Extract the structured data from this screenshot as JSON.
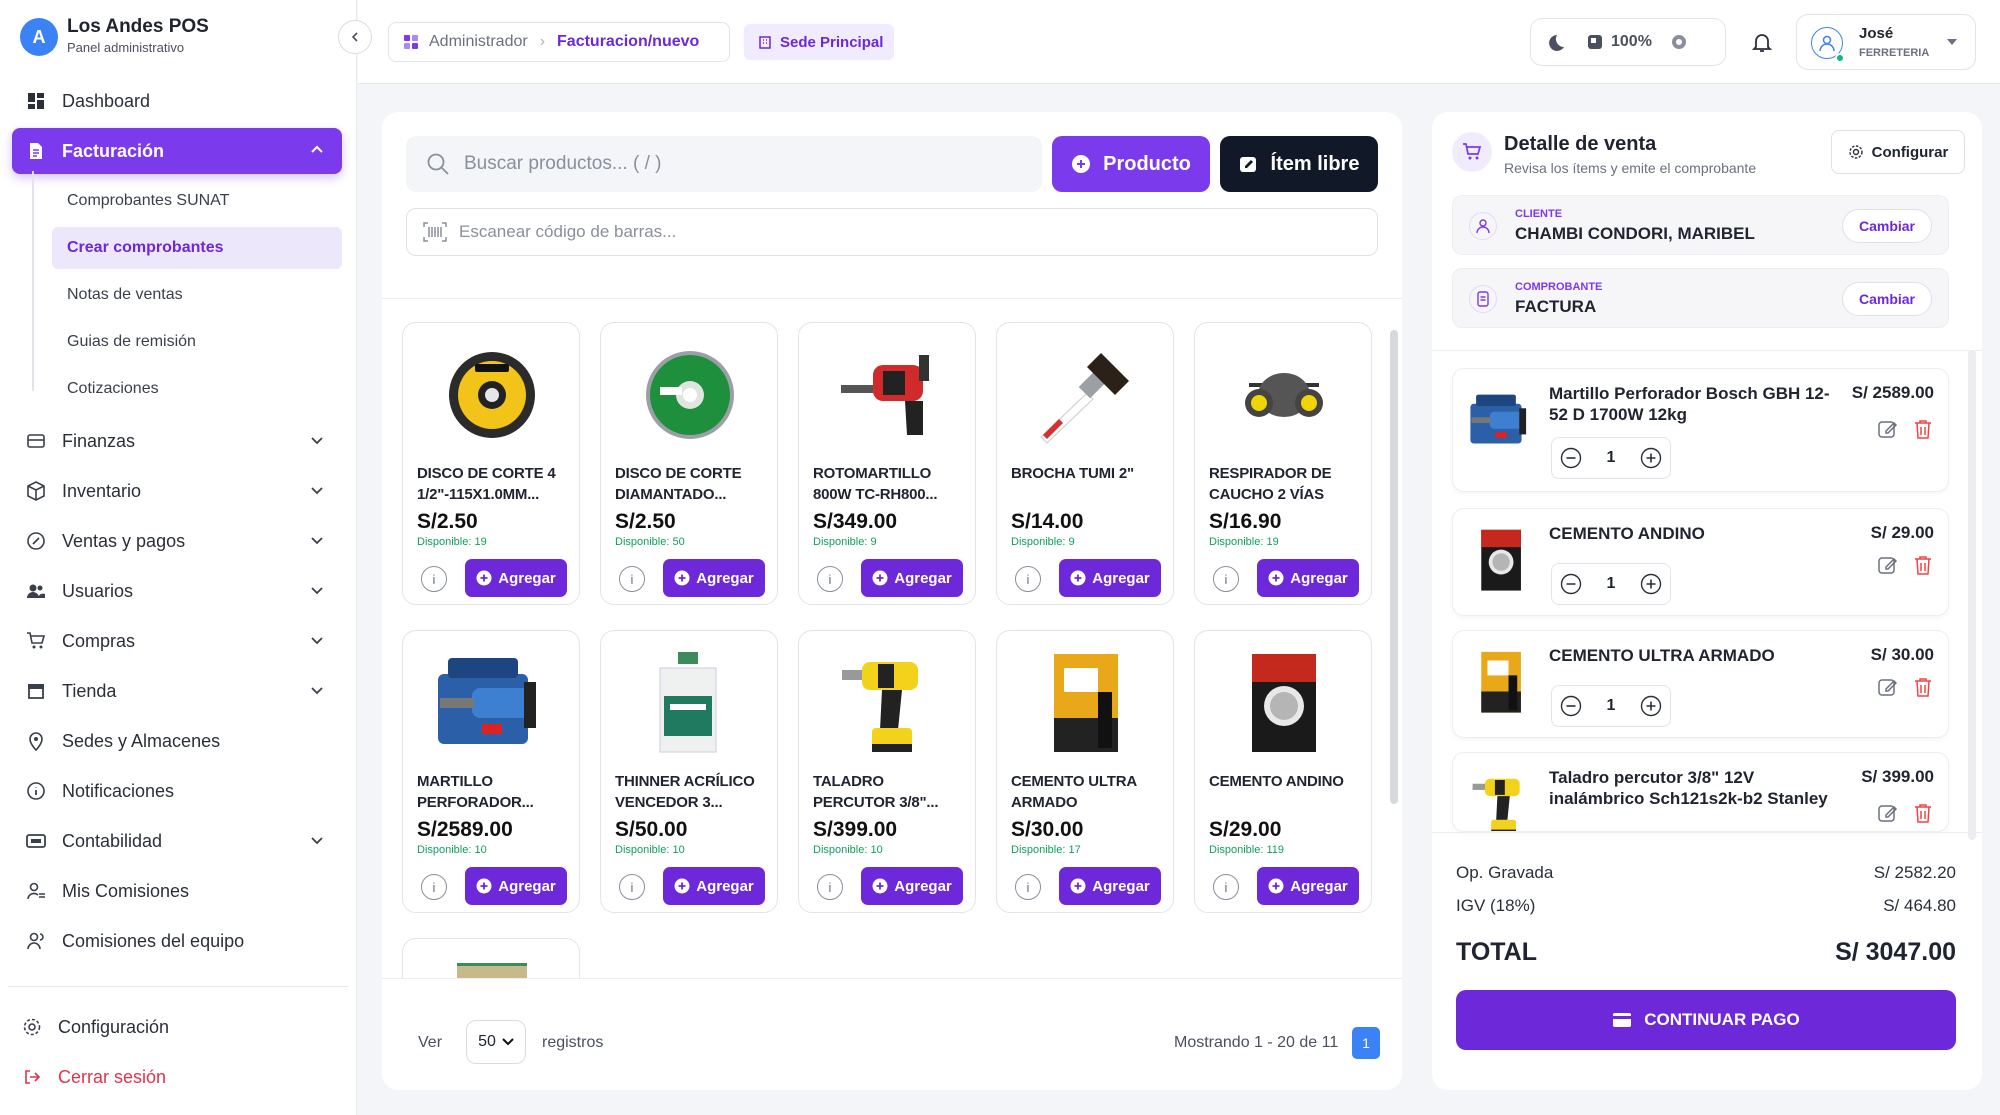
{
  "app": {
    "title": "Los Andes POS",
    "subtitle": "Panel administrativo",
    "logo_text": "A"
  },
  "sidebar": {
    "items": [
      {
        "label": "Dashboard",
        "icon": "dashboard-icon"
      },
      {
        "label": "Facturación",
        "icon": "invoice-icon",
        "active": true,
        "expanded": true
      },
      {
        "label": "Finanzas",
        "icon": "finance-icon"
      },
      {
        "label": "Inventario",
        "icon": "box-icon"
      },
      {
        "label": "Ventas y pagos",
        "icon": "sales-icon"
      },
      {
        "label": "Usuarios",
        "icon": "users-icon"
      },
      {
        "label": "Compras",
        "icon": "cart-icon"
      },
      {
        "label": "Tienda",
        "icon": "store-icon"
      },
      {
        "label": "Sedes y Almacenes",
        "icon": "location-icon"
      },
      {
        "label": "Notificaciones",
        "icon": "info-icon"
      },
      {
        "label": "Contabilidad",
        "icon": "accounting-icon"
      },
      {
        "label": "Mis Comisiones",
        "icon": "commission-icon"
      },
      {
        "label": "Comisiones del equipo",
        "icon": "team-icon"
      }
    ],
    "subitems": [
      "Comprobantes SUNAT",
      "Crear comprobantes",
      "Notas de ventas",
      "Guias de remisión",
      "Cotizaciones"
    ],
    "config": "Configuración",
    "logout": "Cerrar sesión"
  },
  "topbar": {
    "crumb_root": "Administrador",
    "crumb_current": "Facturacion/nuevo",
    "sede": "Sede Principal",
    "zoom": "100%",
    "user_name": "José",
    "user_role": "FERRETERIA"
  },
  "products": {
    "search_placeholder": "Buscar productos... ( / )",
    "btn_producto": "Producto",
    "btn_item_libre": "Ítem libre",
    "scan_placeholder": "Escanear código de barras...",
    "add_label": "Agregar",
    "items": [
      {
        "name": "DISCO DE CORTE 4 1/2\"-115X1.0MM...",
        "price": "S/2.50",
        "stock": "Disponible: 19",
        "img": "disc-yellow"
      },
      {
        "name": "DISCO DE CORTE DIAMANTADO...",
        "price": "S/2.50",
        "stock": "Disponible: 50",
        "img": "disc-green"
      },
      {
        "name": "ROTOMARTILLO 800W TC-RH800...",
        "price": "S/349.00",
        "stock": "Disponible: 9",
        "img": "drill-red"
      },
      {
        "name": "BROCHA TUMI 2\"",
        "price": "S/14.00",
        "stock": "Disponible: 9",
        "img": "brush"
      },
      {
        "name": "RESPIRADOR DE CAUCHO 2 VÍAS",
        "price": "S/16.90",
        "stock": "Disponible: 19",
        "img": "respirator"
      },
      {
        "name": "MARTILLO PERFORADOR...",
        "price": "S/2589.00",
        "stock": "Disponible: 10",
        "img": "drill-blue"
      },
      {
        "name": "THINNER ACRÍLICO VENCEDOR 3...",
        "price": "S/50.00",
        "stock": "Disponible: 10",
        "img": "jug"
      },
      {
        "name": "TALADRO PERCUTOR 3/8\"...",
        "price": "S/399.00",
        "stock": "Disponible: 10",
        "img": "drill-yellow"
      },
      {
        "name": "CEMENTO ULTRA ARMADO",
        "price": "S/30.00",
        "stock": "Disponible: 17",
        "img": "bag-yellow"
      },
      {
        "name": "CEMENTO ANDINO",
        "price": "S/29.00",
        "stock": "Disponible: 119",
        "img": "bag-red"
      }
    ],
    "footer": {
      "ver": "Ver",
      "per_page": "50",
      "registros": "registros",
      "showing": "Mostrando 1 - 20 de 11",
      "page": "1"
    }
  },
  "detail": {
    "title": "Detalle de venta",
    "subtitle": "Revisa los ítems y emite el comprobante",
    "config_btn": "Configurar",
    "client_label": "CLIENTE",
    "client_value": "CHAMBI CONDORI, MARIBEL",
    "doc_label": "COMPROBANTE",
    "doc_value": "FACTURA",
    "change": "Cambiar",
    "lines": [
      {
        "name": "Martillo Perforador Bosch GBH 12-52 D 1700W 12kg",
        "price": "S/ 2589.00",
        "qty": "1",
        "img": "drill-blue"
      },
      {
        "name": "CEMENTO ANDINO",
        "price": "S/ 29.00",
        "qty": "1",
        "img": "bag-red"
      },
      {
        "name": "CEMENTO ULTRA ARMADO",
        "price": "S/ 30.00",
        "qty": "1",
        "img": "bag-yellow"
      },
      {
        "name": "Taladro percutor 3/8\" 12V inalámbrico Sch121s2k-b2 Stanley",
        "price": "S/ 399.00",
        "qty": "1",
        "img": "drill-yellow"
      }
    ],
    "op_gravada_label": "Op. Gravada",
    "op_gravada": "S/ 2582.20",
    "igv_label": "IGV (18%)",
    "igv": "S/ 464.80",
    "total_label": "TOTAL",
    "total": "S/ 3047.00",
    "pay_label": "CONTINUAR PAGO"
  },
  "colors": {
    "accent": "#7c3aed",
    "page_btn": "#3b82f6",
    "stock": "#10a05a",
    "danger": "#ef4444"
  }
}
